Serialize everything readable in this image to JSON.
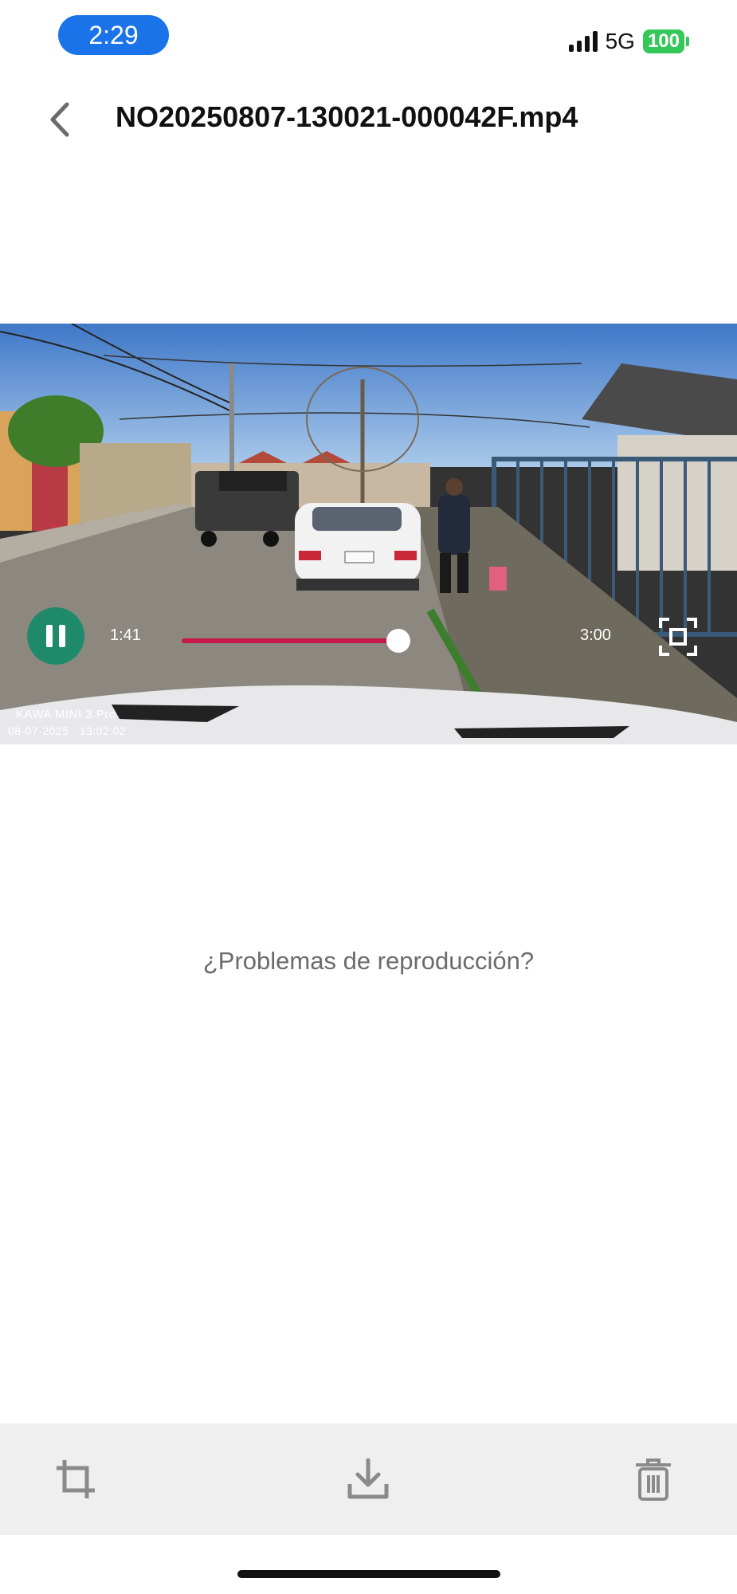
{
  "status_bar": {
    "time": "2:29",
    "network": "5G",
    "battery": "100",
    "colors": {
      "time_pill": "#1a73e8",
      "battery": "#34c759"
    }
  },
  "header": {
    "back_icon": "chevron-left-icon",
    "title": "NO20250807-130021-000042F.mp4"
  },
  "player": {
    "current_time": "1:41",
    "total_time": "3:00",
    "progress_fraction": 0.561,
    "overlay_brand": "KAWA MINI 3 Pro",
    "overlay_timestamp": "08-07-2025   13:02:02",
    "icons": {
      "play_state": "pause-icon",
      "fullscreen": "fullscreen-icon"
    },
    "colors": {
      "pause_button": "#1f8a6a",
      "seek_bar": "#c8174a"
    }
  },
  "playback_help": "¿Problemas de reproducción?",
  "toolbar": {
    "icons": [
      "crop-icon",
      "download-icon",
      "trash-icon"
    ]
  }
}
